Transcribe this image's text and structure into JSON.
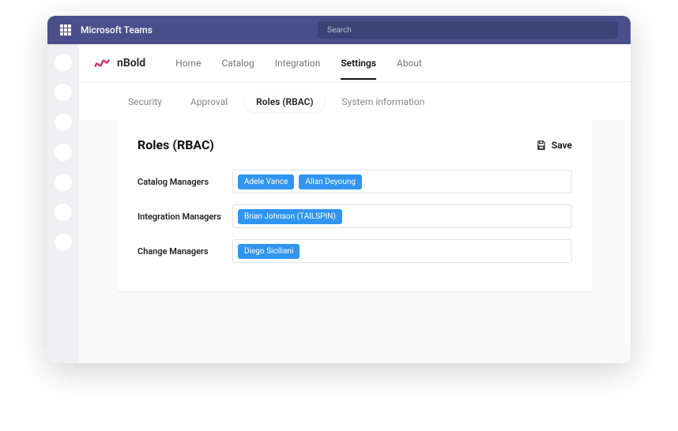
{
  "titlebar": {
    "appTitle": "Microsoft Teams",
    "searchPlaceholder": "Search"
  },
  "brand": {
    "name": "nBold",
    "logoColor": "#d82b6e"
  },
  "appnav": [
    {
      "label": "Home",
      "active": false
    },
    {
      "label": "Catalog",
      "active": false
    },
    {
      "label": "Integration",
      "active": false
    },
    {
      "label": "Settings",
      "active": true
    },
    {
      "label": "About",
      "active": false
    }
  ],
  "subtabs": [
    {
      "label": "Security",
      "active": false
    },
    {
      "label": "Approval",
      "active": false
    },
    {
      "label": "Roles (RBAC)",
      "active": true
    },
    {
      "label": "System information",
      "active": false
    }
  ],
  "card": {
    "title": "Roles (RBAC)",
    "saveLabel": "Save"
  },
  "rows": [
    {
      "label": "Catalog Managers",
      "chips": [
        "Adele Vance",
        "Allan Deyoung"
      ]
    },
    {
      "label": "Integration Managers",
      "chips": [
        "Brian Johnson (TAILSPIN)"
      ]
    },
    {
      "label": "Change Managers",
      "chips": [
        "Diego Siciliani"
      ]
    }
  ],
  "leftrailCount": 7
}
